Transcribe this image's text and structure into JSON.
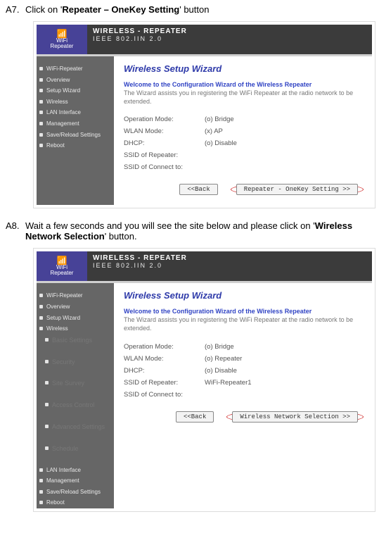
{
  "steps": {
    "A7": {
      "id": "A7.",
      "before": "Click on '",
      "bold": "Repeater – OneKey Setting",
      "after": "' button"
    },
    "A8": {
      "id": "A8.",
      "before": "Wait a few seconds and you will see the site below and please click on '",
      "bold": "Wireless Network Selection",
      "after": "' button."
    }
  },
  "logo": {
    "top": "WiFi",
    "bottom": "Repeater"
  },
  "header": {
    "l1": "WIRELESS - REPEATER",
    "l2": "IEEE 802.IIN 2.0"
  },
  "nav1": [
    "WiFi-Repeater",
    "Overview",
    "Setup Wizard",
    "Wireless",
    "LAN Interface",
    "Management",
    "Save/Reload Settings",
    "Reboot"
  ],
  "nav2": {
    "top": [
      "WiFi-Repeater",
      "Overview",
      "Setup Wizard",
      "Wireless"
    ],
    "sub": [
      "Basic Settings",
      "Security",
      "Site Survey",
      "Access Control",
      "Advanced Settings",
      "Schedule"
    ],
    "rest": [
      "LAN Interface",
      "Management",
      "Save/Reload Settings",
      "Reboot"
    ]
  },
  "wiz": {
    "title": "Wireless Setup Wizard",
    "welcome": "Welcome to the Configuration Wizard of the Wireless Repeater",
    "desc": "The Wizard assists you in registering the WiFi Repeater at the radio network to be extended."
  },
  "form1": [
    {
      "label": "Operation Mode:",
      "value": "(o) Bridge"
    },
    {
      "label": "WLAN Mode:",
      "value": "(x) AP"
    },
    {
      "label": "DHCP:",
      "value": "(o) Disable"
    },
    {
      "label": "SSID of Repeater:",
      "value": ""
    },
    {
      "label": "SSID of Connect to:",
      "value": ""
    }
  ],
  "form2": [
    {
      "label": "Operation Mode:",
      "value": "(o) Bridge"
    },
    {
      "label": "WLAN Mode:",
      "value": "(o) Repeater"
    },
    {
      "label": "DHCP:",
      "value": "(o) Disable"
    },
    {
      "label": "SSID of Repeater:",
      "value": "WiFi-Repeater1"
    },
    {
      "label": "SSID of Connect to:",
      "value": ""
    }
  ],
  "buttons": {
    "back": "<<Back",
    "next1": "Repeater - OneKey Setting >>",
    "next2": "Wireless Network Selection >>"
  }
}
